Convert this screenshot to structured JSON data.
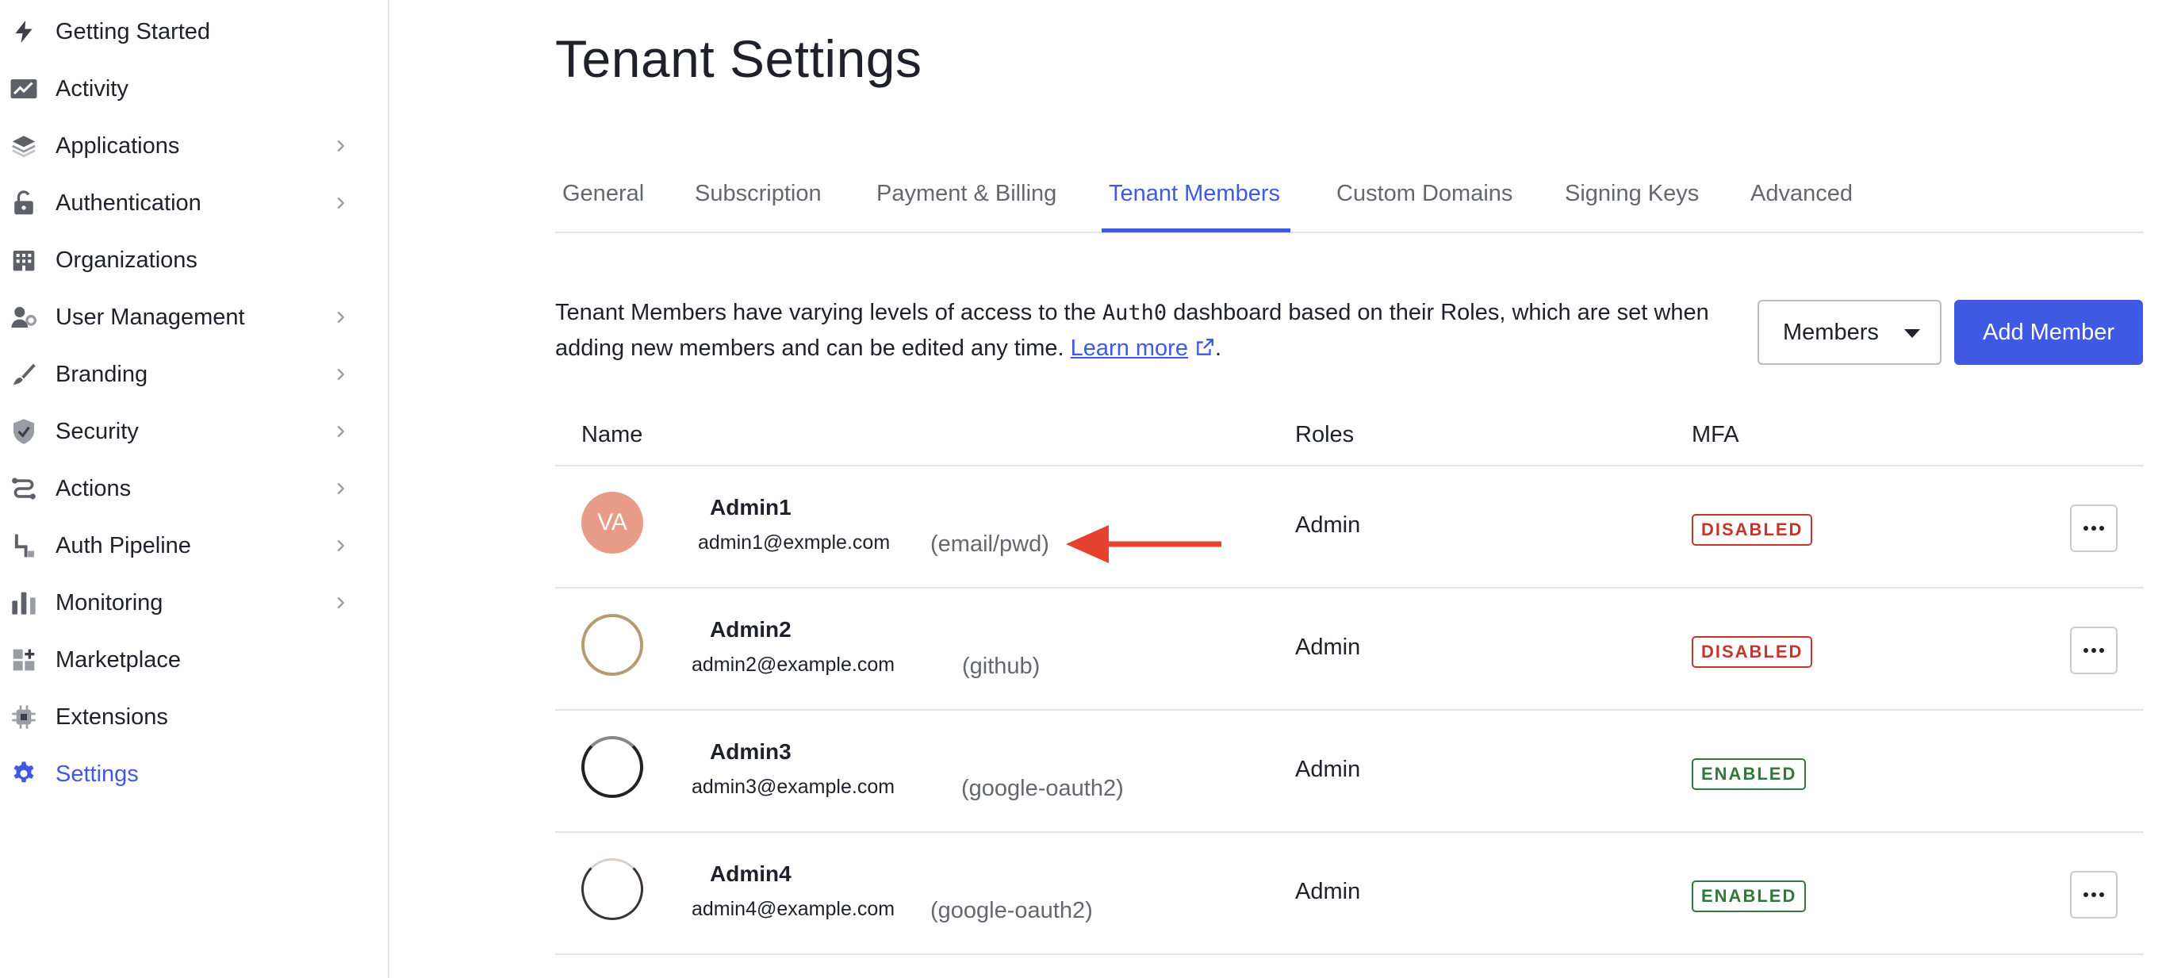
{
  "sidebar": {
    "items": [
      {
        "label": "Getting Started",
        "icon": "bolt-icon",
        "has_chevron": false
      },
      {
        "label": "Activity",
        "icon": "activity-chart-icon",
        "has_chevron": false
      },
      {
        "label": "Applications",
        "icon": "layers-icon",
        "has_chevron": true
      },
      {
        "label": "Authentication",
        "icon": "unlock-icon",
        "has_chevron": true
      },
      {
        "label": "Organizations",
        "icon": "building-icon",
        "has_chevron": false
      },
      {
        "label": "User Management",
        "icon": "user-gear-icon",
        "has_chevron": true
      },
      {
        "label": "Branding",
        "icon": "brush-icon",
        "has_chevron": true
      },
      {
        "label": "Security",
        "icon": "shield-check-icon",
        "has_chevron": true
      },
      {
        "label": "Actions",
        "icon": "flow-icon",
        "has_chevron": true
      },
      {
        "label": "Auth Pipeline",
        "icon": "pipeline-icon",
        "has_chevron": true
      },
      {
        "label": "Monitoring",
        "icon": "bar-chart-icon",
        "has_chevron": true
      },
      {
        "label": "Marketplace",
        "icon": "grid-plus-icon",
        "has_chevron": false
      },
      {
        "label": "Extensions",
        "icon": "chip-icon",
        "has_chevron": false
      },
      {
        "label": "Settings",
        "icon": "gear-icon",
        "has_chevron": false,
        "active": true
      }
    ]
  },
  "page": {
    "title": "Tenant Settings"
  },
  "tabs": [
    {
      "label": "General"
    },
    {
      "label": "Subscription"
    },
    {
      "label": "Payment & Billing"
    },
    {
      "label": "Tenant Members",
      "active": true
    },
    {
      "label": "Custom Domains"
    },
    {
      "label": "Signing Keys"
    },
    {
      "label": "Advanced"
    }
  ],
  "description": {
    "text_before": "Tenant Members have varying levels of access to the ",
    "brand": "Auth0",
    "text_after": " dashboard based on their Roles, which are set when adding new members and can be edited any time. ",
    "link": "Learn more",
    "end": "."
  },
  "controls": {
    "filter_value": "Members",
    "add_label": "Add Member"
  },
  "table": {
    "headers": {
      "name": "Name",
      "roles": "Roles",
      "mfa": "MFA"
    },
    "rows": [
      {
        "avatar": "VA",
        "name": "Admin1",
        "email": "admin1@exmple.com",
        "connection": "(email/pwd)",
        "role": "Admin",
        "mfa": "DISABLED"
      },
      {
        "avatar": "",
        "name": "Admin2",
        "email": "admin2@example.com",
        "connection": "(github)",
        "role": "Admin",
        "mfa": "DISABLED"
      },
      {
        "avatar": "",
        "name": "Admin3",
        "email": "admin3@example.com",
        "connection": "(google-oauth2)",
        "role": "Admin",
        "mfa": "ENABLED"
      },
      {
        "avatar": "",
        "name": "Admin4",
        "email": "admin4@example.com",
        "connection": "(google-oauth2)",
        "role": "Admin",
        "mfa": "ENABLED"
      }
    ]
  },
  "colors": {
    "accent": "#3f59e4",
    "disabled": "#c4352b",
    "enabled": "#2f7a3a",
    "annotation_arrow": "#e5422f",
    "avatar_initials_bg": "#e89b86"
  }
}
